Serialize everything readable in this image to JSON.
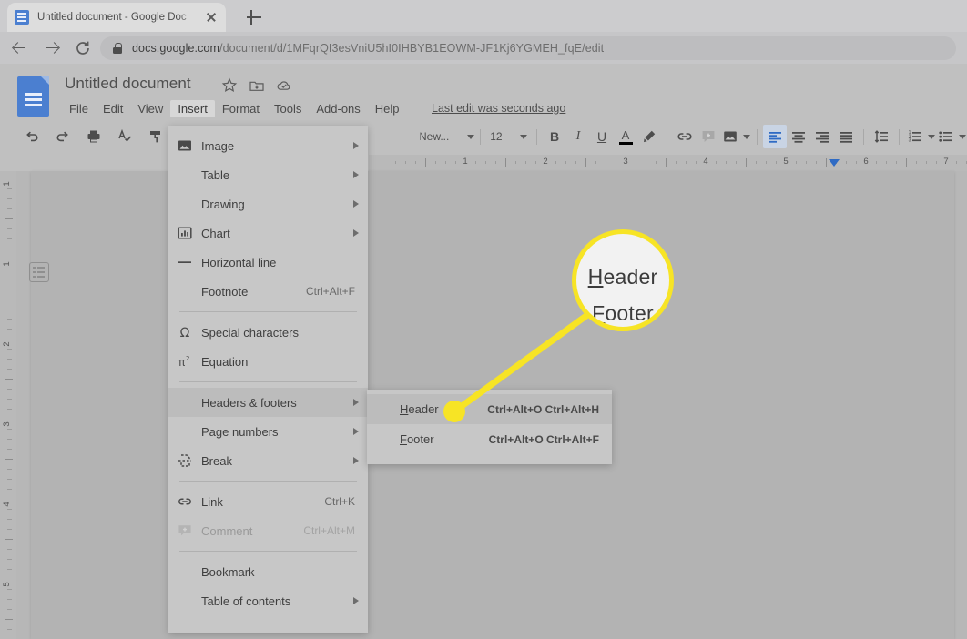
{
  "browser": {
    "tab": {
      "title": "Untitled document - Google Doc",
      "favicon": "google-docs-favicon",
      "close_icon": "close-icon"
    },
    "new_tab_icon": "plus-icon",
    "back_icon": "arrow-back-icon",
    "forward_icon": "arrow-forward-icon",
    "reload_icon": "reload-icon",
    "lock_icon": "lock-icon",
    "url_domain": "docs.google.com",
    "url_path": "/document/d/1MFqrQI3esVniU5hI0IHBYB1EOWM-JF1Kj6YGMEH_fqE/edit"
  },
  "docs": {
    "logo_icon": "google-docs-logo-icon",
    "document_title": "Untitled document",
    "title_icons": [
      "star-icon",
      "move-to-folder-icon",
      "cloud-saved-icon"
    ],
    "menus": [
      {
        "label": "File",
        "active": false
      },
      {
        "label": "Edit",
        "active": false
      },
      {
        "label": "View",
        "active": false
      },
      {
        "label": "Insert",
        "active": true
      },
      {
        "label": "Format",
        "active": false
      },
      {
        "label": "Tools",
        "active": false
      },
      {
        "label": "Add-ons",
        "active": false
      },
      {
        "label": "Help",
        "active": false
      }
    ],
    "last_edit": "Last edit was seconds ago",
    "toolbar": {
      "font_name": "New...",
      "font_size": "12",
      "bold": "B",
      "italic": "I",
      "underline": "U",
      "text_color": "A",
      "icons": [
        "undo-icon",
        "redo-icon",
        "print-icon",
        "spelling-check-icon",
        "paint-format-icon",
        "bold-icon",
        "italic-icon",
        "underline-icon",
        "text-color-icon",
        "highlight-color-icon",
        "insert-link-icon",
        "add-comment-icon",
        "insert-image-icon",
        "align-left-icon",
        "align-center-icon",
        "align-right-icon",
        "justify-icon",
        "line-spacing-icon",
        "numbered-list-icon",
        "bulleted-list-icon"
      ],
      "text_color_swatch": "#000000",
      "active_align": "align-left-icon",
      "active_align_bg": "#c9d4e4"
    },
    "ruler": {
      "horizontal_numbers": [
        "1",
        "2",
        "3",
        "4",
        "5",
        "6",
        "7"
      ],
      "vertical_numbers": [
        "1",
        "1",
        "2",
        "3",
        "4"
      ],
      "margin_marker": "right-margin-marker"
    },
    "outline_button": "document-outline-icon",
    "page_background": "#b3b3b3"
  },
  "insert_menu": {
    "items": [
      {
        "label": "Image",
        "icon": "image-icon",
        "accel": "",
        "submenu": true,
        "divider_after": false,
        "highlighted": false,
        "disabled": false
      },
      {
        "label": "Table",
        "icon": "",
        "accel": "",
        "submenu": true,
        "divider_after": false,
        "highlighted": false,
        "disabled": false
      },
      {
        "label": "Drawing",
        "icon": "",
        "accel": "",
        "submenu": true,
        "divider_after": false,
        "highlighted": false,
        "disabled": false
      },
      {
        "label": "Chart",
        "icon": "chart-icon",
        "accel": "",
        "submenu": true,
        "divider_after": false,
        "highlighted": false,
        "disabled": false
      },
      {
        "label": "Horizontal line",
        "icon": "horizontal-line-icon",
        "accel": "",
        "submenu": false,
        "divider_after": false,
        "highlighted": false,
        "disabled": false
      },
      {
        "label": "Footnote",
        "icon": "",
        "accel": "Ctrl+Alt+F",
        "submenu": false,
        "divider_after": true,
        "highlighted": false,
        "disabled": false
      },
      {
        "label": "Special characters",
        "icon": "omega-icon",
        "accel": "",
        "submenu": false,
        "divider_after": false,
        "highlighted": false,
        "disabled": false
      },
      {
        "label": "Equation",
        "icon": "equation-icon",
        "accel": "",
        "submenu": false,
        "divider_after": true,
        "highlighted": false,
        "disabled": false
      },
      {
        "label": "Headers & footers",
        "icon": "",
        "accel": "",
        "submenu": true,
        "divider_after": false,
        "highlighted": true,
        "disabled": false
      },
      {
        "label": "Page numbers",
        "icon": "",
        "accel": "",
        "submenu": true,
        "divider_after": false,
        "highlighted": false,
        "disabled": false
      },
      {
        "label": "Break",
        "icon": "break-icon",
        "accel": "",
        "submenu": true,
        "divider_after": true,
        "highlighted": false,
        "disabled": false
      },
      {
        "label": "Link",
        "icon": "link-icon",
        "accel": "Ctrl+K",
        "submenu": false,
        "divider_after": false,
        "highlighted": false,
        "disabled": false
      },
      {
        "label": "Comment",
        "icon": "comment-icon",
        "accel": "Ctrl+Alt+M",
        "submenu": false,
        "divider_after": true,
        "highlighted": false,
        "disabled": true
      },
      {
        "label": "Bookmark",
        "icon": "",
        "accel": "",
        "submenu": false,
        "divider_after": false,
        "highlighted": false,
        "disabled": false
      },
      {
        "label": "Table of contents",
        "icon": "",
        "accel": "",
        "submenu": true,
        "divider_after": false,
        "highlighted": false,
        "disabled": false
      }
    ]
  },
  "headers_footers_submenu": {
    "items": [
      {
        "label_first": "H",
        "label_rest": "eader",
        "accel": "Ctrl+Alt+O Ctrl+Alt+H",
        "highlighted": true
      },
      {
        "label_first": "F",
        "label_rest": "ooter",
        "accel": "Ctrl+Alt+O Ctrl+Alt+F",
        "highlighted": false
      }
    ]
  },
  "callout": {
    "highlight_color": "#f7e425",
    "magnified_primary": "Header",
    "magnified_secondary": "Footer"
  }
}
